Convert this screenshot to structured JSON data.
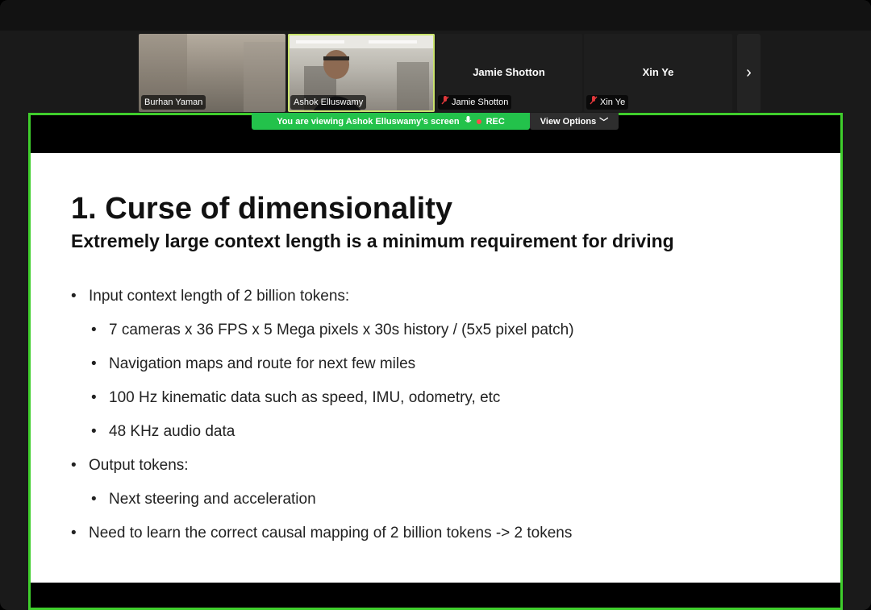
{
  "participants": [
    {
      "name": "Burhan Yaman",
      "video": true,
      "muted": false
    },
    {
      "name": "Ashok Elluswamy",
      "video": true,
      "muted": false,
      "active": true
    },
    {
      "name": "Jamie Shotton",
      "video": false,
      "muted": true
    },
    {
      "name": "Xin Ye",
      "video": false,
      "muted": true
    }
  ],
  "banner": {
    "viewing_text": "You are viewing  Ashok Elluswamy's screen",
    "rec_label": "REC",
    "view_options_label": "View Options",
    "chevron": "﹀",
    "mic_glyph": "🎙",
    "mic_off_glyph": "🎙̸",
    "next_glyph": "›"
  },
  "slide": {
    "title": "1. Curse of dimensionality",
    "subtitle": "Extremely large context length is a minimum requirement for driving",
    "bullets": [
      {
        "level": 1,
        "text": "Input context length of 2 billion tokens:"
      },
      {
        "level": 2,
        "text": "7 cameras x 36 FPS x 5 Mega pixels x 30s history / (5x5 pixel patch)"
      },
      {
        "level": 2,
        "text": "Navigation maps and route for next few miles"
      },
      {
        "level": 2,
        "text": "100 Hz kinematic data such as speed, IMU, odometry, etc"
      },
      {
        "level": 2,
        "text": "48 KHz audio data"
      },
      {
        "level": 1,
        "text": "Output tokens:"
      },
      {
        "level": 2,
        "text": "Next steering and acceleration"
      },
      {
        "level": 1,
        "text": "Need to learn the correct causal mapping of 2 billion tokens -> 2 tokens"
      }
    ]
  },
  "colors": {
    "share_border": "#3fce2c",
    "banner_green": "#23c24b",
    "active_speaker": "#c9e36c",
    "mic_off_red": "#e0383b"
  }
}
